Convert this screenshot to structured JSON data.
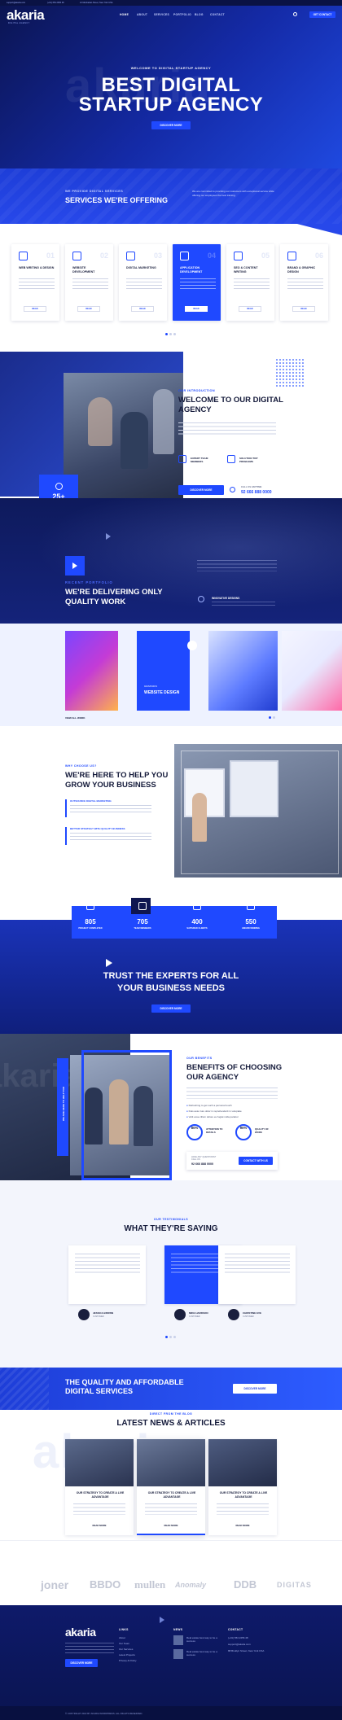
{
  "topbar": {
    "email": "support@akaria.com",
    "phone": "(+01) 654 2456 48",
    "address": "21 Manhattan Street, New York USA"
  },
  "header": {
    "logo": "akaria",
    "tagline": "DIGITAL AGENCY",
    "nav": [
      "HOME",
      "ABOUT",
      "SERVICES",
      "PORTFOLIO",
      "BLOG",
      "CONTACT"
    ],
    "cta": "GET CONTACT"
  },
  "hero": {
    "kicker": "WELCOME TO DIGITAL STARTUP AGENCY",
    "title_line1": "BEST DIGITAL",
    "title_line2": "STARTUP AGENCY",
    "button": "DISCOVER MORE",
    "ghost": "akaria"
  },
  "services": {
    "kicker": "WE PROVIDE DIGITAL SERVICES",
    "title": "SERVICES WE'RE OFFERING",
    "intro": "We are committed to providing our customers with exceptional service while offering our employees the best training.",
    "items": [
      {
        "num": "01",
        "title": "WEB WRITING & DESIGN",
        "button": "READ"
      },
      {
        "num": "02",
        "title": "WEBSITE DEVELOPMENT",
        "button": "READ"
      },
      {
        "num": "03",
        "title": "DIGITAL MARKETING",
        "button": "READ"
      },
      {
        "num": "04",
        "title": "APPLICATION DEVELOPMENT",
        "button": "READ"
      },
      {
        "num": "05",
        "title": "SEO & CONTENT WRITING",
        "button": "READ"
      },
      {
        "num": "06",
        "title": "BRAND & GRAPHIC DESIGN",
        "button": "READ"
      }
    ]
  },
  "about": {
    "kicker": "OUR INTRODUCTION",
    "title_line1": "WELCOME TO OUR DIGITAL",
    "title_line2": "AGENCY",
    "years": "25+",
    "years_label": "YEARS OF EXPERIENCE",
    "feature1": "EXPERT TEAM MEMBERS",
    "feature2": "SOLUTION TOP PROBLEMS",
    "button": "DISCOVER MORE",
    "call_label": "CALL US ANYTIME",
    "phone": "92 666 888 0000"
  },
  "portfolio": {
    "kicker": "RECENT PORTFOLIO",
    "title_line1": "WE'RE DELIVERING ONLY",
    "title_line2": "QUALITY WORK",
    "text_heading": "INNOVATIVE DESIGNS",
    "tile_tag": "GRAPHICS",
    "tile_title": "WEBSITE DESIGN",
    "view_all": "VIEW ALL WORK"
  },
  "help": {
    "kicker": "WHY CHOOSE US?",
    "title_line1": "WE'RE HERE TO HELP YOU",
    "title_line2": "GROW YOUR BUSINESS",
    "point1": "OUTSOURCE DIGITAL MARKETING",
    "point2": "BETTER STRATEGY WITH QUALITY BUSINESS"
  },
  "stats": {
    "items": [
      {
        "value": "805",
        "label": "PROJECT COMPLETED"
      },
      {
        "value": "705",
        "label": "TEAM MEMBERS"
      },
      {
        "value": "400",
        "label": "SATISFIED CLIENTS"
      },
      {
        "value": "550",
        "label": "AWARD WINNING"
      }
    ],
    "video_title_line1": "TRUST THE EXPERTS FOR ALL",
    "video_title_line2": "YOUR BUSINESS NEEDS",
    "button": "DISCOVER MORE"
  },
  "benefits": {
    "kicker": "OUR BENEFITS",
    "title_line1": "BENEFITS OF CHOOSING",
    "title_line2": "OUR AGENCY",
    "vertical_text": "WE ARE HERE TO HELP YOU",
    "check1": "Refreshing to get such a personal touch",
    "check2": "Duis aute irure dolor in reprehenderit in voluptate",
    "check3": "Velit esse cillum dolore eu fugiat nulla pariatur",
    "pct1": "80%",
    "pct1_label": "ATTENTION TO DETAILS",
    "pct2": "90%",
    "pct2_label": "QUALITY OF WORK",
    "call_label": "HAVE ANY QUESTIONS? CALL US",
    "phone": "92 666 888 0000",
    "button": "CONTACT WITH US"
  },
  "testimonial": {
    "kicker": "OUR TESTIMONIALS",
    "title": "WHAT THEY'RE SAYING",
    "items": [
      {
        "name": "JESSICA BROWN",
        "role": "CUSTOMER"
      },
      {
        "name": "MIKE HARDSON",
        "role": "CUSTOMER"
      },
      {
        "name": "CHRISTINE EVE",
        "role": "CUSTOMER"
      }
    ]
  },
  "cta": {
    "title_line1": "THE QUALITY AND AFFORDABLE",
    "title_line2": "DIGITAL SERVICES",
    "button": "DISCOVER MORE"
  },
  "news": {
    "kicker": "DIRECT FROM THE BLOG",
    "title": "LATEST NEWS & ARTICLES",
    "ghost": "akaria",
    "items": [
      {
        "title": "OUR STRATEGY TO CREATE A LIVE ADVANTAGE",
        "more": "READ MORE"
      },
      {
        "title": "OUR STRATEGY TO CREATE A LIVE ADVANTAGE",
        "more": "READ MORE"
      },
      {
        "title": "OUR STRATEGY TO CREATE A LIVE ADVANTAGE",
        "more": "READ MORE"
      }
    ]
  },
  "partners": [
    "joner",
    "BBDO",
    "mullen",
    "Anomaly",
    "DDB",
    "DIGITAS"
  ],
  "footer": {
    "logo": "akaria",
    "button": "DISCOVER MORE",
    "col_links": "LINKS",
    "links": [
      "About",
      "Our Team",
      "Our Services",
      "Latest Projects",
      "Privacy & Policy"
    ],
    "col_news": "NEWS",
    "news1": "Real estate best way to be a success",
    "news2": "Real estate best way to be a success",
    "col_contact": "CONTACT",
    "phone": "(+01) 654 2456 48",
    "email": "support@akaria.com",
    "address": "88 Broklyn Street, New York USA",
    "copyright": "© COPYRIGHT 2022 BY AKARIA WORDPRESS. ALL RIGHTS RESERVED."
  }
}
